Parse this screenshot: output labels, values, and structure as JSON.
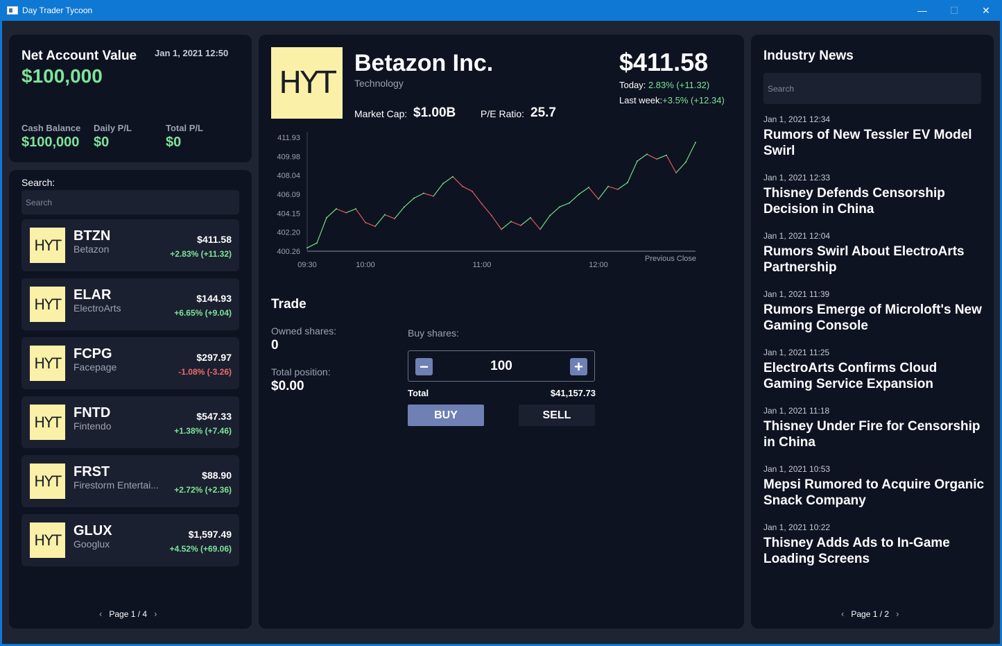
{
  "window": {
    "title": "Day Trader Tycoon",
    "minimize": "—",
    "maximize": "☐",
    "close": "✕"
  },
  "account": {
    "net_label": "Net Account Value",
    "date": "Jan 1, 2021 12:50",
    "net_value": "$100,000",
    "cash_label": "Cash Balance",
    "cash_value": "$100,000",
    "daily_label": "Daily P/L",
    "daily_value": "$0",
    "total_label": "Total P/L",
    "total_value": "$0"
  },
  "stock_list": {
    "search_label": "Search:",
    "search_placeholder": "Search",
    "logo_text": "HYT",
    "stocks": [
      {
        "ticker": "BTZN",
        "name": "Betazon",
        "price": "$411.58",
        "change": "+2.83% (+11.32)",
        "positive": true
      },
      {
        "ticker": "ELAR",
        "name": "ElectroArts",
        "price": "$144.93",
        "change": "+6.65% (+9.04)",
        "positive": true
      },
      {
        "ticker": "FCPG",
        "name": "Facepage",
        "price": "$297.97",
        "change": "-1.08% (-3.26)",
        "positive": false
      },
      {
        "ticker": "FNTD",
        "name": "Fintendo",
        "price": "$547.33",
        "change": "+1.38% (+7.46)",
        "positive": true
      },
      {
        "ticker": "FRST",
        "name": "Firestorm Entertai...",
        "price": "$88.90",
        "change": "+2.72% (+2.36)",
        "positive": true
      },
      {
        "ticker": "GLUX",
        "name": "Googlux",
        "price": "$1,597.49",
        "change": "+4.52% (+69.06)",
        "positive": true
      }
    ],
    "pager": {
      "prev": "‹",
      "text": "Page 1 / 4",
      "next": "›"
    }
  },
  "detail": {
    "logo_text": "HYT",
    "company": "Betazon Inc.",
    "sector": "Technology",
    "market_cap_label": "Market Cap:",
    "market_cap": "$1.00B",
    "pe_label": "P/E Ratio:",
    "pe": "25.7",
    "price": "$411.58",
    "today_label": "Today:",
    "today_value": "2.83% (+11.32)",
    "week_label": "Last week:",
    "week_value": "+3.5% (+12.34)"
  },
  "trade": {
    "title": "Trade",
    "owned_label": "Owned shares:",
    "owned_value": "0",
    "position_label": "Total position:",
    "position_value": "$0.00",
    "buy_shares_label": "Buy shares:",
    "quantity": "100",
    "minus": "−",
    "plus": "+",
    "total_label": "Total",
    "total_value": "$41,157.73",
    "buy_label": "BUY",
    "sell_label": "SELL"
  },
  "news": {
    "title": "Industry News",
    "search_placeholder": "Search",
    "items": [
      {
        "date": "Jan 1, 2021 12:34",
        "headline": "Rumors of New Tessler EV Model Swirl"
      },
      {
        "date": "Jan 1, 2021 12:33",
        "headline": "Thisney Defends Censorship Decision in China"
      },
      {
        "date": "Jan 1, 2021 12:04",
        "headline": "Rumors Swirl About ElectroArts Partnership"
      },
      {
        "date": "Jan 1, 2021 11:39",
        "headline": "Rumors Emerge of Microloft's New Gaming Console"
      },
      {
        "date": "Jan 1, 2021 11:25",
        "headline": "ElectroArts Confirms Cloud Gaming Service Expansion"
      },
      {
        "date": "Jan 1, 2021 11:18",
        "headline": "Thisney Under Fire for Censorship in China"
      },
      {
        "date": "Jan 1, 2021 10:53",
        "headline": "Mepsi Rumored to Acquire Organic Snack Company"
      },
      {
        "date": "Jan 1, 2021 10:22",
        "headline": "Thisney Adds Ads to In-Game Loading Screens"
      }
    ],
    "pager": {
      "prev": "‹",
      "text": "Page 1 / 2",
      "next": "›"
    }
  },
  "chart_data": {
    "type": "line",
    "yticks": [
      "411.93",
      "409.98",
      "408.04",
      "406.09",
      "404.15",
      "402.20",
      "400.26"
    ],
    "ylim": [
      400.26,
      411.93
    ],
    "xticks": [
      "09:30",
      "10:00",
      "11:00",
      "12:00"
    ],
    "x_start": "09:30",
    "x_end": "12:50",
    "reference_label": "Previous Close",
    "up_color": "#6ee07f",
    "down_color": "#e05a5a",
    "x": [
      "09:30",
      "09:35",
      "09:40",
      "09:45",
      "09:50",
      "09:55",
      "10:00",
      "10:05",
      "10:10",
      "10:15",
      "10:20",
      "10:25",
      "10:30",
      "10:35",
      "10:40",
      "10:45",
      "10:50",
      "10:55",
      "11:00",
      "11:05",
      "11:10",
      "11:15",
      "11:20",
      "11:25",
      "11:30",
      "11:35",
      "11:40",
      "11:45",
      "11:50",
      "11:55",
      "12:00",
      "12:05",
      "12:10",
      "12:15",
      "12:20",
      "12:25",
      "12:30",
      "12:35",
      "12:40",
      "12:45",
      "12:50"
    ],
    "values": [
      400.6,
      401.1,
      403.7,
      404.6,
      404.2,
      404.6,
      403.2,
      402.8,
      404.0,
      403.6,
      404.8,
      405.7,
      406.2,
      405.9,
      407.2,
      407.9,
      406.9,
      406.4,
      405.1,
      403.9,
      402.5,
      403.3,
      402.9,
      403.7,
      402.5,
      403.9,
      404.8,
      405.2,
      406.1,
      406.8,
      405.6,
      406.9,
      406.6,
      407.3,
      409.5,
      410.2,
      409.7,
      410.1,
      408.3,
      409.4,
      411.4
    ]
  }
}
